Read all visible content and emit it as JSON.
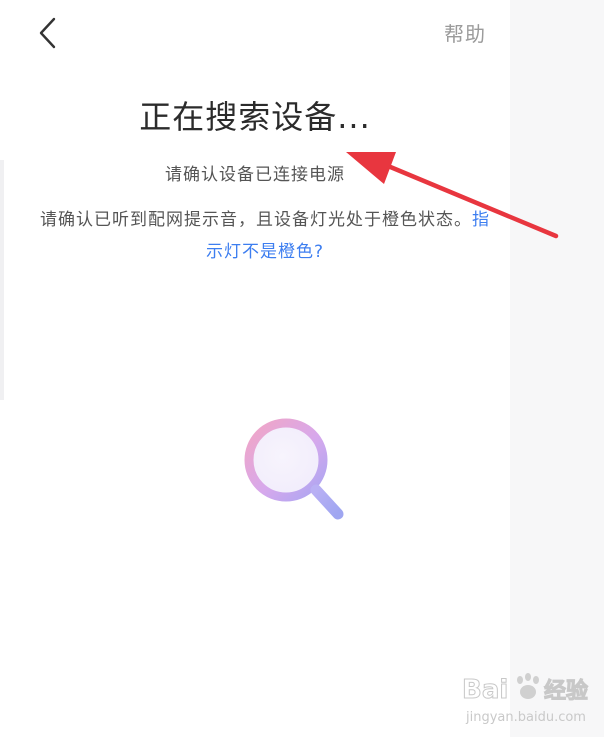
{
  "header": {
    "back_icon": "chevron-left-icon",
    "help_label": "帮助"
  },
  "main": {
    "title": "正在搜索设备...",
    "subtitle": "请确认设备已连接电源",
    "instruction_text": "请确认已听到配网提示音，且设备灯光处于橙色状态。",
    "instruction_link": "指示灯不是橙色?",
    "search_icon": "search-icon"
  },
  "annotation": {
    "arrow_color": "#e8363f"
  },
  "watermark": {
    "brand": "Baidu经验",
    "url": "jingyan.baidu.com"
  },
  "colors": {
    "link": "#3d7ef0",
    "title": "#2b2b2b",
    "body_text": "#555555",
    "muted": "#9b9b9b"
  }
}
